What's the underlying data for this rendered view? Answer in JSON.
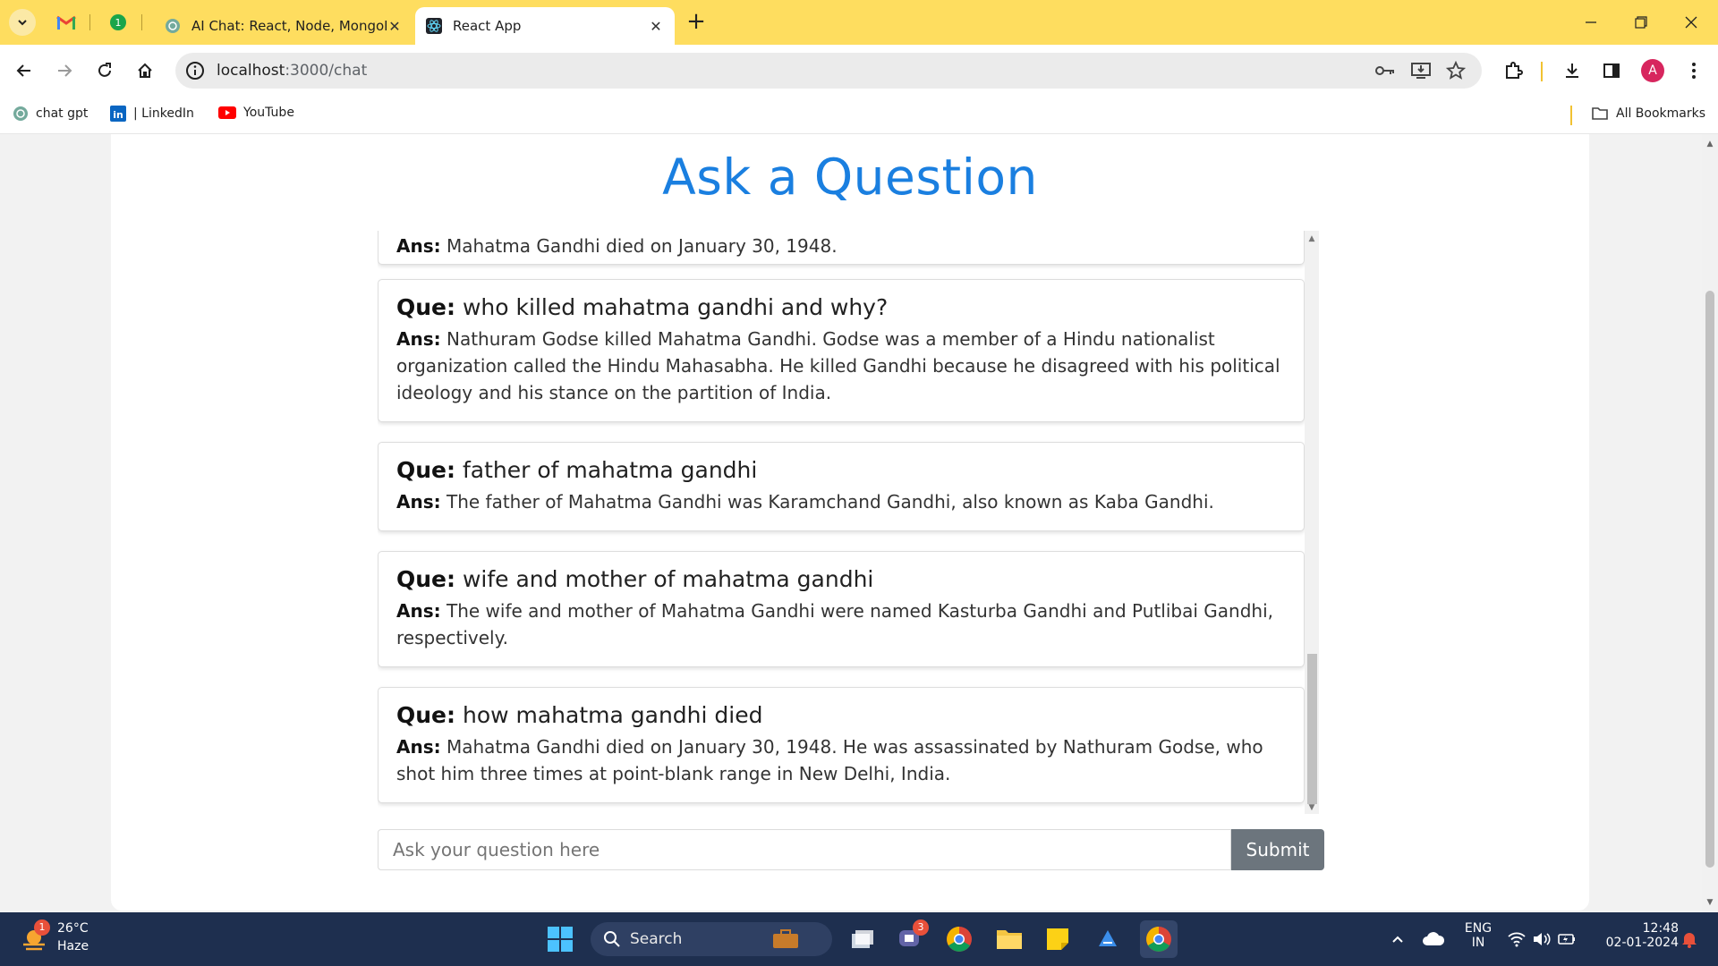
{
  "browser": {
    "tabs": [
      {
        "title": "AI Chat: React, Node, MongoDB",
        "active": false
      },
      {
        "title": "React App",
        "active": true
      }
    ],
    "new_tab_label": "+",
    "address": {
      "host": "localhost",
      "path": ":3000/chat"
    },
    "profile_initial": "A",
    "bookmarks": [
      {
        "label": "chat gpt",
        "icon": "chatgpt-icon"
      },
      {
        "label": "| LinkedIn",
        "icon": "linkedin-icon"
      },
      {
        "label": "YouTube",
        "icon": "youtube-icon"
      }
    ],
    "all_bookmarks_label": "All Bookmarks"
  },
  "page": {
    "title": "Ask a Question",
    "que_label": "Que:",
    "ans_label": "Ans:",
    "conversation": [
      {
        "question": "",
        "answer": "Mahatma Gandhi died on January 30, 1948."
      },
      {
        "question": "who killed mahatma gandhi and why?",
        "answer": "Nathuram Godse killed Mahatma Gandhi. Godse was a member of a Hindu nationalist organization called the Hindu Mahasabha. He killed Gandhi because he disagreed with his political ideology and his stance on the partition of India."
      },
      {
        "question": "father of mahatma gandhi",
        "answer": "The father of Mahatma Gandhi was Karamchand Gandhi, also known as Kaba Gandhi."
      },
      {
        "question": "wife and mother of mahatma gandhi",
        "answer": "The wife and mother of Mahatma Gandhi were named Kasturba Gandhi and Putlibai Gandhi, respectively."
      },
      {
        "question": "how mahatma gandhi died",
        "answer": "Mahatma Gandhi died on January 30, 1948. He was assassinated by Nathuram Godse, who shot him three times at point-blank range in New Delhi, India."
      }
    ],
    "input_placeholder": "Ask your question here",
    "submit_label": "Submit"
  },
  "taskbar": {
    "weather_temp": "26°C",
    "weather_condition": "Haze",
    "weather_badge": "1",
    "search_label": "Search",
    "teams_badge": "3",
    "language": "ENG",
    "region": "IN",
    "time": "12:48",
    "date": "02-01-2024"
  },
  "colors": {
    "tab_strip": "#fedd5f",
    "title_blue": "#1a7fe0",
    "submit_gray": "#6c757d",
    "taskbar": "#1e2f4f"
  }
}
